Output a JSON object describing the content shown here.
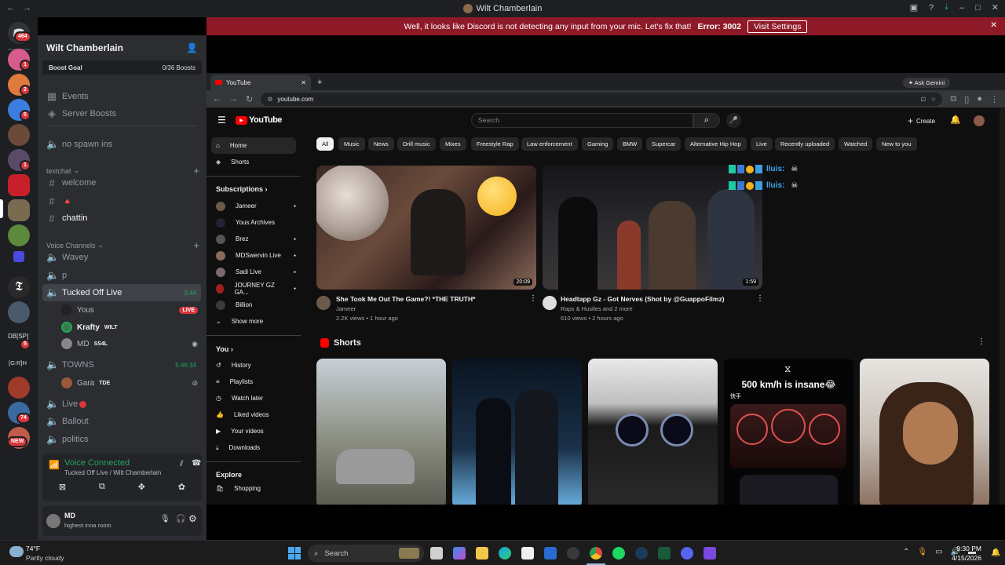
{
  "window": {
    "title": "Wilt Chamberlain"
  },
  "banner": {
    "text": "Well, it looks like Discord is not detecting any input from your mic. Let's fix that!",
    "error": "Error: 3002",
    "button": "Visit Settings"
  },
  "rail": {
    "home_badge": "464",
    "badges": [
      "1",
      "2",
      "5",
      "1",
      "5",
      "74"
    ],
    "text_servers": [
      "DB[SP]",
      "[G:R]H"
    ],
    "new_label": "NEW"
  },
  "server": {
    "name": "Wilt Chamberlain",
    "boost_goal": "Boost Goal",
    "boost_count": "0/36 Boosts",
    "events": "Events",
    "server_boosts": "Server Boosts",
    "no_spawn": "no spawn ins",
    "cat_text": "textchat",
    "ch_welcome": "welcome",
    "ch_emoji": "🔺",
    "ch_chattin": "chattin",
    "cat_voice": "Voice Channels",
    "vc_wavey": "Wavey",
    "vc_p": "p",
    "vc_tucked": "Tucked Off Live",
    "vc_tucked_time": "3:44",
    "user_yous": "Yous",
    "live_badge": "LIVE",
    "user_krafty": "Krafty",
    "krafty_tag": "WILT",
    "user_md": "MD",
    "md_tag": "SS4L",
    "vc_towns": "TOWNS",
    "vc_towns_time": "5:46:34",
    "user_gara": "Gara",
    "gara_tag": "TDE",
    "vc_live": "Live",
    "vc_ballout": "Ballout",
    "vc_politics": "politics"
  },
  "voice": {
    "status": "Voice Connected",
    "channel": "Tucked Off Live / Wilt Chamberlain"
  },
  "user": {
    "name": "MD",
    "status": "highest inna room"
  },
  "browser": {
    "tab_title": "YouTube",
    "url": "youtube.com",
    "ask": "Ask Gemini"
  },
  "youtube": {
    "logo": "YouTube",
    "search_placeholder": "Search",
    "create": "Create",
    "nav": {
      "home": "Home",
      "shorts": "Shorts"
    },
    "subs_header": "Subscriptions",
    "subs": [
      "Jameer",
      "Yous Archives",
      "Brez",
      "MDSwervin Live",
      "Sadi Live",
      "JOURNEY GZ GA...",
      "Billion"
    ],
    "show_more": "Show more",
    "you_header": "You",
    "you_items": [
      "History",
      "Playlists",
      "Watch later",
      "Liked videos",
      "Your videos",
      "Downloads"
    ],
    "explore_header": "Explore",
    "explore_items": [
      "Shopping"
    ],
    "chips": [
      "All",
      "Music",
      "News",
      "Drill music",
      "Mixes",
      "Freestyle Rap",
      "Law enforcement",
      "Gaming",
      "BMW",
      "Supercar",
      "Alternative Hip Hop",
      "Live",
      "Recently uploaded",
      "Watched",
      "New to you"
    ],
    "videos": [
      {
        "title": "She Took Me Out The Game?! *THE TRUTH*",
        "channel": "Jameer",
        "meta": "2.2K views • 1 hour ago",
        "duration": "20:09"
      },
      {
        "title": "Headtapp Gz - Got Nerves (Shot by @GuappoFilmz)",
        "channel": "Raps & Hustles and 2 more",
        "meta": "610 views • 2 hours ago",
        "duration": "1:59",
        "overlay": "lluis:"
      }
    ],
    "shorts_header": "Shorts",
    "short_caption": "500 km/h is insane😂",
    "short_logo": "快手"
  },
  "taskbar": {
    "temp": "74°F",
    "weather": "Partly cloudy",
    "search": "Search",
    "time": "9:30 PM",
    "date": "4/15/2026"
  }
}
